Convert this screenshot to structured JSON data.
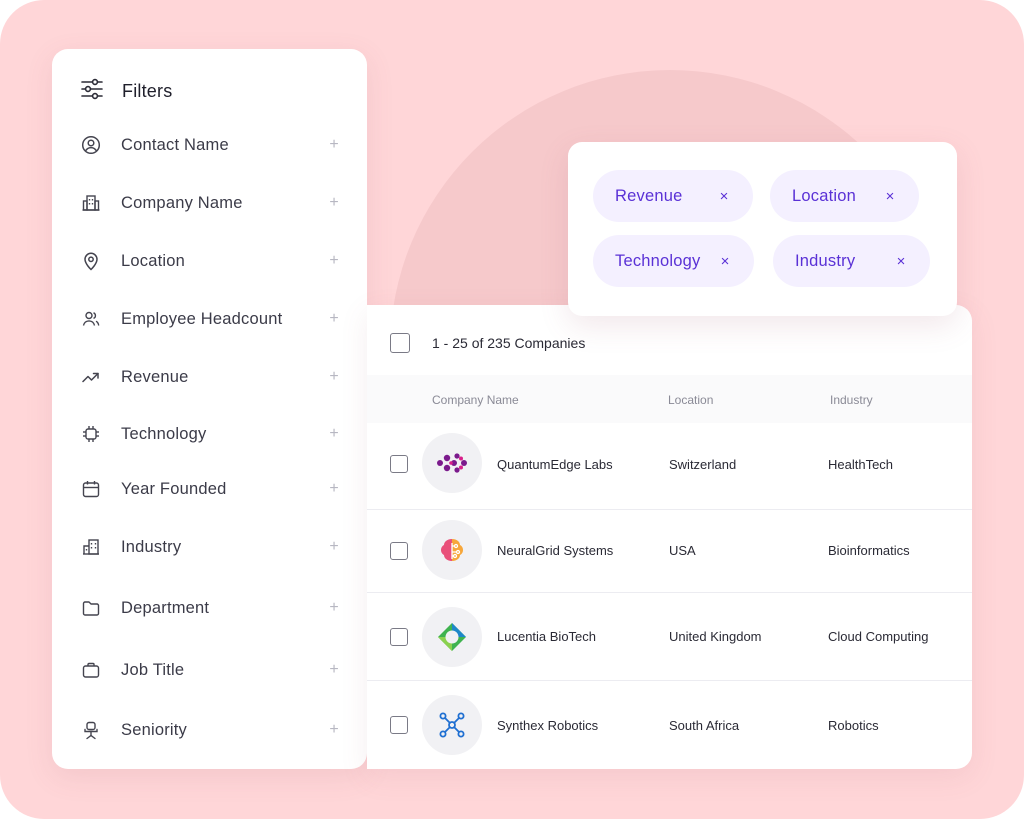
{
  "filters": {
    "title": "Filters",
    "items": [
      {
        "label": "Contact Name",
        "icon": "user-circle-icon"
      },
      {
        "label": "Company Name",
        "icon": "building-icon"
      },
      {
        "label": "Location",
        "icon": "location-pin-icon"
      },
      {
        "label": "Employee Headcount",
        "icon": "users-icon"
      },
      {
        "label": "Revenue",
        "icon": "trend-up-icon"
      },
      {
        "label": "Technology",
        "icon": "chip-icon"
      },
      {
        "label": "Year Founded",
        "icon": "calendar-icon"
      },
      {
        "label": "Industry",
        "icon": "office-buildings-icon"
      },
      {
        "label": "Department",
        "icon": "folder-icon"
      },
      {
        "label": "Job Title",
        "icon": "briefcase-icon"
      },
      {
        "label": "Seniority",
        "icon": "chair-icon"
      }
    ],
    "expand_symbol": "+"
  },
  "chips": [
    {
      "label": "Revenue",
      "remove": "×"
    },
    {
      "label": "Location",
      "remove": "×"
    },
    {
      "label": "Technology",
      "remove": "×"
    },
    {
      "label": "Industry",
      "remove": "×"
    }
  ],
  "table": {
    "summary": "1 - 25 of 235 Companies",
    "columns": [
      "Company Name",
      "Location",
      "Industry"
    ],
    "rows": [
      {
        "company": "QuantumEdge Labs",
        "location": "Switzerland",
        "industry": "HealthTech",
        "logo": "molecule-logo"
      },
      {
        "company": "NeuralGrid Systems",
        "location": "USA",
        "industry": "Bioinformatics",
        "logo": "brain-logo"
      },
      {
        "company": "Lucentia BioTech",
        "location": "United Kingdom",
        "industry": "Cloud Computing",
        "logo": "ring-logo"
      },
      {
        "company": "Synthex Robotics",
        "location": "South Africa",
        "industry": "Robotics",
        "logo": "network-logo"
      }
    ]
  },
  "colors": {
    "background": "#ffd6d8",
    "accent": "#5a31d6",
    "chip_bg": "#f4f0ff"
  }
}
